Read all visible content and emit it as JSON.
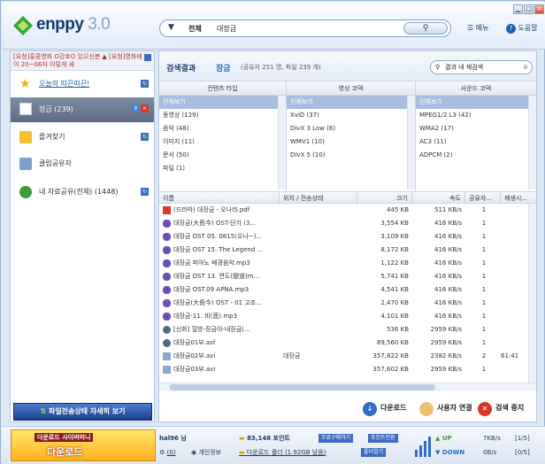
{
  "app": {
    "logo": "enppy",
    "version": "3.0"
  },
  "search": {
    "scope": "전체",
    "query": "대장금",
    "button": "검색"
  },
  "topmenu": {
    "menu": "메뉴",
    "help": "도움말"
  },
  "ticker": "[요청]홍콩영화 O강호O 있으신분 ▲ [요청]영화에이 20~06자 이렇게 새",
  "sidebar": {
    "items": [
      {
        "label": "오늘의 따끈따끈!"
      },
      {
        "label": "장금 (239)"
      },
      {
        "label": "즐겨찾기"
      },
      {
        "label": "클럽공유자"
      },
      {
        "label": "내 자료공유(전체) (1448)"
      }
    ],
    "transfer_button": "파일전송상태 자세히 보기"
  },
  "results": {
    "title": "검색결과",
    "keyword": "장금",
    "count": "(공유자 251 명, 파일 239 개)",
    "subsearch_placeholder": "결과 내 재검색"
  },
  "filters": [
    {
      "header": "컨텐츠 타입",
      "rows": [
        "전체보기",
        "동영상 (129)",
        "음악 (48)",
        "이미지 (11)",
        "문서 (50)",
        "파일 (1)"
      ]
    },
    {
      "header": "영상 코덱",
      "rows": [
        "전체보기",
        "XviD (37)",
        "DivX 3 Low (6)",
        "WMV1 (10)",
        "DivX 5 (10)"
      ]
    },
    {
      "header": "사운드 코덱",
      "rows": [
        "전체보기",
        "MPEG1/2 L3 (42)",
        "WMA2 (17)",
        "AC3 (11)",
        "ADPCM (2)"
      ]
    }
  ],
  "list": {
    "columns": [
      "이름",
      "위치 / 전송상태",
      "크기",
      "속도",
      "공유자...",
      "재생시..."
    ],
    "rows": [
      {
        "icon": "pdf",
        "name": "(드라마) 대장금 - 오나라.pdf",
        "loc": "",
        "size": "445 KB",
        "speed": "511 KB/s",
        "sharers": "1",
        "play": ""
      },
      {
        "icon": "music",
        "name": "대장금(大長今) OST-단가 (3...",
        "loc": "",
        "size": "3,554 KB",
        "speed": "416 KB/s",
        "sharers": "1",
        "play": ""
      },
      {
        "icon": "music",
        "name": "대장금 OST 05. 0815(오나~)...",
        "loc": "",
        "size": "3,109 KB",
        "speed": "416 KB/s",
        "sharers": "1",
        "play": ""
      },
      {
        "icon": "music",
        "name": "대장금 OST 15. The Legend ...",
        "loc": "",
        "size": "8,172 KB",
        "speed": "416 KB/s",
        "sharers": "1",
        "play": ""
      },
      {
        "icon": "music",
        "name": "대장금 피아노 배경음악.mp3",
        "loc": "",
        "size": "1,122 KB",
        "speed": "416 KB/s",
        "sharers": "1",
        "play": ""
      },
      {
        "icon": "music",
        "name": "대장금 OST 13. 연도(戀道)m...",
        "loc": "",
        "size": "5,741 KB",
        "speed": "416 KB/s",
        "sharers": "1",
        "play": ""
      },
      {
        "icon": "music",
        "name": "대장금 OST.09 APNA.mp3",
        "loc": "",
        "size": "4,541 KB",
        "speed": "416 KB/s",
        "sharers": "1",
        "play": ""
      },
      {
        "icon": "music",
        "name": "대장금(大長今) OST - 01 고조...",
        "loc": "",
        "size": "2,470 KB",
        "speed": "416 KB/s",
        "sharers": "1",
        "play": ""
      },
      {
        "icon": "music",
        "name": "대장금-11. 비(悲).mp3",
        "loc": "",
        "size": "4,101 KB",
        "speed": "416 KB/s",
        "sharers": "1",
        "play": ""
      },
      {
        "icon": "video",
        "name": "[신화] 힐방-장금이-내장금(...",
        "loc": "",
        "size": "536 KB",
        "speed": "2959 KB/s",
        "sharers": "1",
        "play": ""
      },
      {
        "icon": "video",
        "name": "대장금01부.asf",
        "loc": "",
        "size": "89,560 KB",
        "speed": "2959 KB/s",
        "sharers": "1",
        "play": ""
      },
      {
        "icon": "file",
        "name": "대장금02부.avi",
        "loc": "대장금",
        "size": "357,822 KB",
        "speed": "2382 KB/s",
        "sharers": "2",
        "play": "61:41"
      },
      {
        "icon": "file",
        "name": "대장금03부.avi",
        "loc": "",
        "size": "357,602 KB",
        "speed": "2959 KB/s",
        "sharers": "1",
        "play": ""
      }
    ]
  },
  "actions": {
    "download": "다운로드",
    "user_connect": "사용자 연결",
    "stop_search": "검색 중지"
  },
  "status": {
    "banner_top": "다운로드 사이버머니",
    "banner_main": "다운로드",
    "user": "hal96 님",
    "points": "83,148 포인트",
    "charge_btn": "무료구매하기",
    "link_btn": "포인트전환",
    "settings_num": "(0)",
    "personal": "개인정보",
    "folder": "다운로드 폴더 (1.92GB 남음)",
    "folder_btn": "폴더열기",
    "up_label": "UP",
    "down_label": "DOWN",
    "up_speed": "7KB/s",
    "down_speed": "0B/s",
    "up_count": "[1/5]",
    "down_count": "[0/5]"
  }
}
